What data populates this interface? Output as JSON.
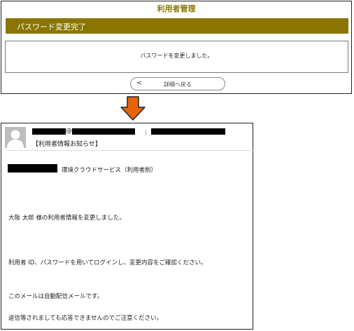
{
  "top_panel": {
    "app_title": "利用者管理",
    "header_title": "パスワード変更完了",
    "message": "パスワードを変更しました。",
    "back_chevron": "<",
    "back_label": "詳細へ戻る",
    "accent_color": "#8a7500"
  },
  "arrow": {
    "color": "#e8620c",
    "icon": "down-arrow-icon"
  },
  "email": {
    "at_sign": "@",
    "subject": "【利用者情報お知らせ】",
    "service_line": "環境クラウドサービス（利用者削）",
    "lines": [
      "大阪 太郎 様の利用者情報を変更しました。",
      "利用者 ID、パスワードを用いてログインし、変更内容をご確認ください。",
      "このメールは自動配信メールです。",
      "返信等されましても応答できませんのでご注意ください。"
    ]
  }
}
